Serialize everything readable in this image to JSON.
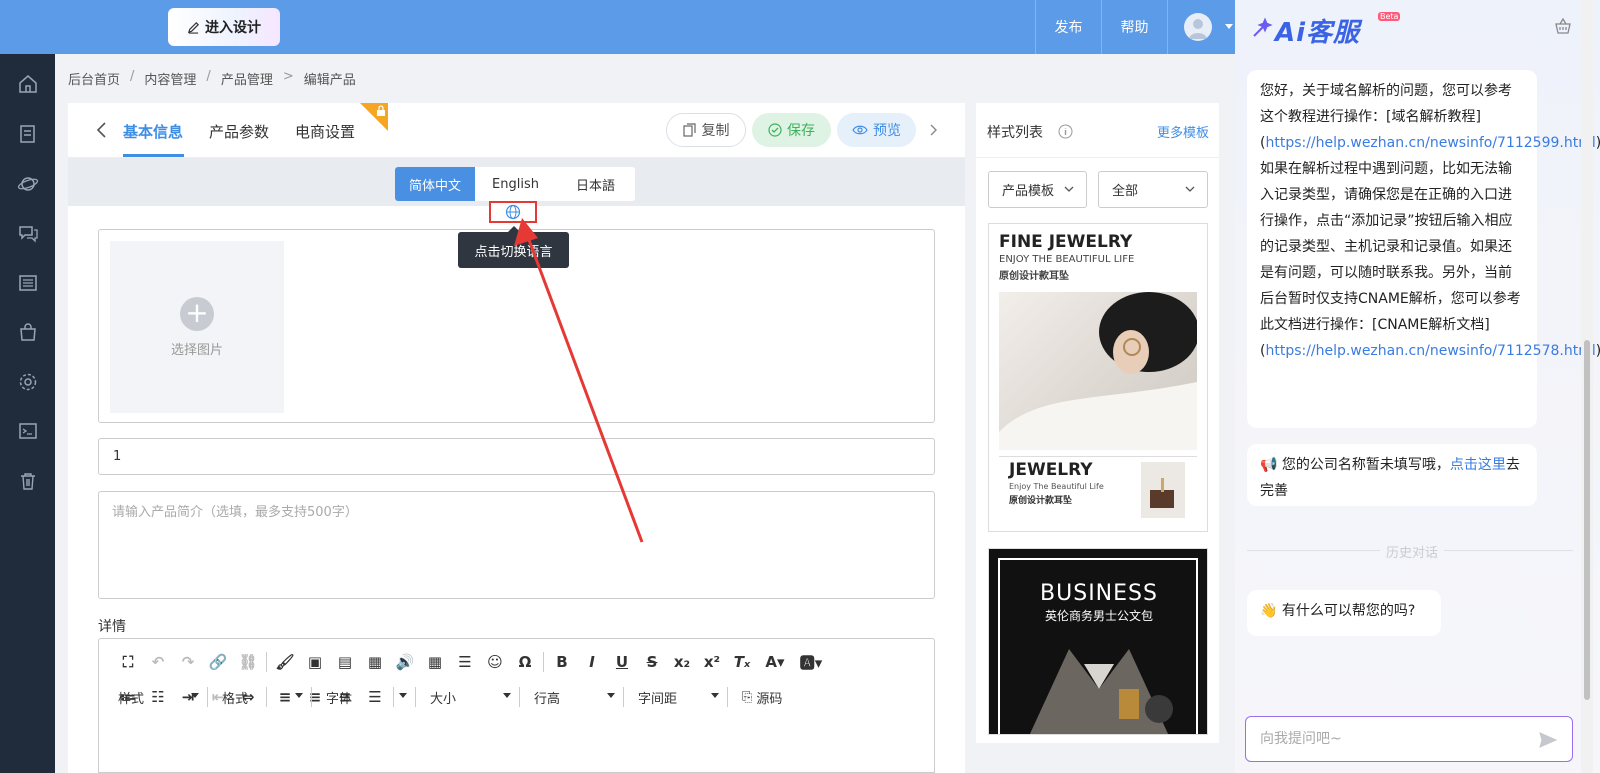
{
  "topbar": {
    "design_label": "进入设计",
    "publish": "发布",
    "help": "帮助"
  },
  "breadcrumb": [
    "后台首页",
    "内容管理",
    "产品管理",
    "编辑产品"
  ],
  "tabs": [
    "基本信息",
    "产品参数",
    "电商设置"
  ],
  "actions": {
    "copy": "复制",
    "save": "保存",
    "preview": "预览"
  },
  "languages": [
    "简体中文",
    "English",
    "日本語"
  ],
  "tooltip": "点击切换语言",
  "image_picker": "选择图片",
  "title_value": "1",
  "intro_placeholder": "请输入产品简介（选填，最多支持500字）",
  "detail_label": "详情",
  "editor_dropdowns": [
    "样式",
    "格式",
    "字体",
    "大小",
    "行高",
    "字间距"
  ],
  "source_label": "源码",
  "style_panel": {
    "title": "样式列表",
    "more": "更多模板",
    "filter1": "产品模板",
    "filter2": "全部",
    "tpl1": {
      "h1": "FINE JEWELRY",
      "h2": "ENJOY THE BEAUTIFUL LIFE",
      "h3": "原创设计款耳坠",
      "b1": "JEWELRY",
      "b2": "Enjoy The Beautiful Life",
      "b3": "原创设计款耳坠"
    },
    "tpl2": {
      "h1": "BUSINESS",
      "h2": "英伦商务男士公文包"
    }
  },
  "chat": {
    "title": "Ai客服",
    "beta": "Beta",
    "msg1_a": "您好，关于域名解析的问题，您可以参考这个教程进行操作：[域名解析教程](",
    "msg1_link1": "https://help.wezhan.cn/newsinfo/7112599.html",
    "msg1_b": ")。如果在解析过程中遇到问题，比如无法输入记录类型，请确保您是在正确的入口进行操作，点击“添加记录”按钮后输入相应的记录类型、主机记录和记录值。如果还是有问题，可以随时联系我。另外，当前后台暂时仅支持CNAME解析，您可以参考此文档进行操作：[CNAME解析文档](",
    "msg1_link2": "https://help.wezhan.cn/newsinfo/7112578.html",
    "msg1_c": ")。",
    "msg2_a": "您的公司名称暂未填写哦，",
    "msg2_link": "点击这里",
    "msg2_b": "去完善",
    "history": "历史对话",
    "msg3": "有什么可以帮您的吗?",
    "input_placeholder": "向我提问吧~"
  }
}
